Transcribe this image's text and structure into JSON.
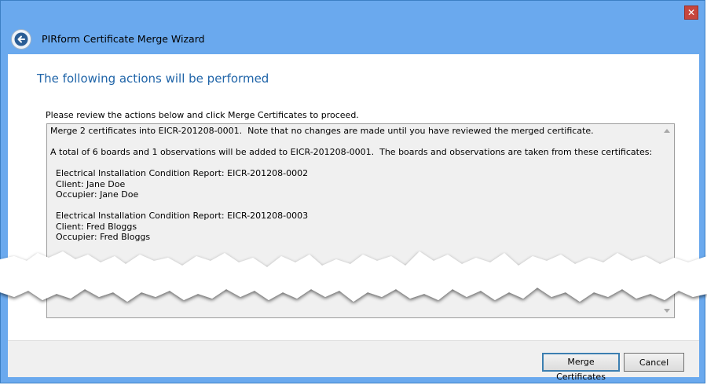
{
  "window": {
    "close_label": "✕"
  },
  "wizard": {
    "title": "PIRform Certificate Merge Wizard",
    "heading": "The following actions will be performed",
    "instruction": "Please review the actions below and click Merge Certificates to proceed.",
    "actions_text": "Merge 2 certificates into EICR-201208-0001.  Note that no changes are made until you have reviewed the merged certificate.\n\nA total of 6 boards and 1 observations will be added to EICR-201208-0001.  The boards and observations are taken from these certificates:\n\n  Electrical Installation Condition Report: EICR-201208-0002\n  Client: Jane Doe\n  Occupier: Jane Doe\n\n  Electrical Installation Condition Report: EICR-201208-0003\n  Client: Fred Bloggs\n  Occupier: Fred Bloggs"
  },
  "buttons": {
    "merge_label": "Merge Certificates",
    "cancel_label": "Cancel"
  },
  "colors": {
    "frame": "#6aa9ee",
    "heading": "#1f64a8",
    "close": "#c7463d"
  }
}
